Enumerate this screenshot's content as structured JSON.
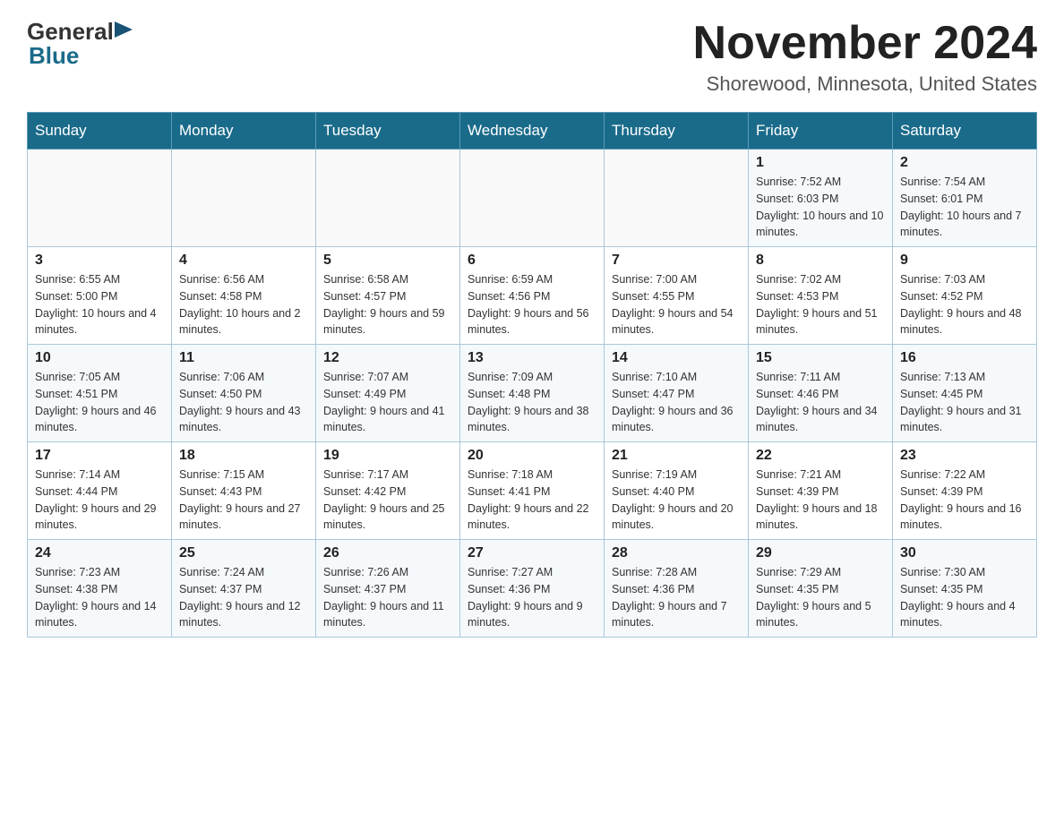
{
  "header": {
    "logo_general": "General",
    "logo_blue": "Blue",
    "month_title": "November 2024",
    "location": "Shorewood, Minnesota, United States"
  },
  "weekdays": [
    "Sunday",
    "Monday",
    "Tuesday",
    "Wednesday",
    "Thursday",
    "Friday",
    "Saturday"
  ],
  "weeks": [
    [
      {
        "day": "",
        "info": ""
      },
      {
        "day": "",
        "info": ""
      },
      {
        "day": "",
        "info": ""
      },
      {
        "day": "",
        "info": ""
      },
      {
        "day": "",
        "info": ""
      },
      {
        "day": "1",
        "info": "Sunrise: 7:52 AM\nSunset: 6:03 PM\nDaylight: 10 hours and 10 minutes."
      },
      {
        "day": "2",
        "info": "Sunrise: 7:54 AM\nSunset: 6:01 PM\nDaylight: 10 hours and 7 minutes."
      }
    ],
    [
      {
        "day": "3",
        "info": "Sunrise: 6:55 AM\nSunset: 5:00 PM\nDaylight: 10 hours and 4 minutes."
      },
      {
        "day": "4",
        "info": "Sunrise: 6:56 AM\nSunset: 4:58 PM\nDaylight: 10 hours and 2 minutes."
      },
      {
        "day": "5",
        "info": "Sunrise: 6:58 AM\nSunset: 4:57 PM\nDaylight: 9 hours and 59 minutes."
      },
      {
        "day": "6",
        "info": "Sunrise: 6:59 AM\nSunset: 4:56 PM\nDaylight: 9 hours and 56 minutes."
      },
      {
        "day": "7",
        "info": "Sunrise: 7:00 AM\nSunset: 4:55 PM\nDaylight: 9 hours and 54 minutes."
      },
      {
        "day": "8",
        "info": "Sunrise: 7:02 AM\nSunset: 4:53 PM\nDaylight: 9 hours and 51 minutes."
      },
      {
        "day": "9",
        "info": "Sunrise: 7:03 AM\nSunset: 4:52 PM\nDaylight: 9 hours and 48 minutes."
      }
    ],
    [
      {
        "day": "10",
        "info": "Sunrise: 7:05 AM\nSunset: 4:51 PM\nDaylight: 9 hours and 46 minutes."
      },
      {
        "day": "11",
        "info": "Sunrise: 7:06 AM\nSunset: 4:50 PM\nDaylight: 9 hours and 43 minutes."
      },
      {
        "day": "12",
        "info": "Sunrise: 7:07 AM\nSunset: 4:49 PM\nDaylight: 9 hours and 41 minutes."
      },
      {
        "day": "13",
        "info": "Sunrise: 7:09 AM\nSunset: 4:48 PM\nDaylight: 9 hours and 38 minutes."
      },
      {
        "day": "14",
        "info": "Sunrise: 7:10 AM\nSunset: 4:47 PM\nDaylight: 9 hours and 36 minutes."
      },
      {
        "day": "15",
        "info": "Sunrise: 7:11 AM\nSunset: 4:46 PM\nDaylight: 9 hours and 34 minutes."
      },
      {
        "day": "16",
        "info": "Sunrise: 7:13 AM\nSunset: 4:45 PM\nDaylight: 9 hours and 31 minutes."
      }
    ],
    [
      {
        "day": "17",
        "info": "Sunrise: 7:14 AM\nSunset: 4:44 PM\nDaylight: 9 hours and 29 minutes."
      },
      {
        "day": "18",
        "info": "Sunrise: 7:15 AM\nSunset: 4:43 PM\nDaylight: 9 hours and 27 minutes."
      },
      {
        "day": "19",
        "info": "Sunrise: 7:17 AM\nSunset: 4:42 PM\nDaylight: 9 hours and 25 minutes."
      },
      {
        "day": "20",
        "info": "Sunrise: 7:18 AM\nSunset: 4:41 PM\nDaylight: 9 hours and 22 minutes."
      },
      {
        "day": "21",
        "info": "Sunrise: 7:19 AM\nSunset: 4:40 PM\nDaylight: 9 hours and 20 minutes."
      },
      {
        "day": "22",
        "info": "Sunrise: 7:21 AM\nSunset: 4:39 PM\nDaylight: 9 hours and 18 minutes."
      },
      {
        "day": "23",
        "info": "Sunrise: 7:22 AM\nSunset: 4:39 PM\nDaylight: 9 hours and 16 minutes."
      }
    ],
    [
      {
        "day": "24",
        "info": "Sunrise: 7:23 AM\nSunset: 4:38 PM\nDaylight: 9 hours and 14 minutes."
      },
      {
        "day": "25",
        "info": "Sunrise: 7:24 AM\nSunset: 4:37 PM\nDaylight: 9 hours and 12 minutes."
      },
      {
        "day": "26",
        "info": "Sunrise: 7:26 AM\nSunset: 4:37 PM\nDaylight: 9 hours and 11 minutes."
      },
      {
        "day": "27",
        "info": "Sunrise: 7:27 AM\nSunset: 4:36 PM\nDaylight: 9 hours and 9 minutes."
      },
      {
        "day": "28",
        "info": "Sunrise: 7:28 AM\nSunset: 4:36 PM\nDaylight: 9 hours and 7 minutes."
      },
      {
        "day": "29",
        "info": "Sunrise: 7:29 AM\nSunset: 4:35 PM\nDaylight: 9 hours and 5 minutes."
      },
      {
        "day": "30",
        "info": "Sunrise: 7:30 AM\nSunset: 4:35 PM\nDaylight: 9 hours and 4 minutes."
      }
    ]
  ]
}
